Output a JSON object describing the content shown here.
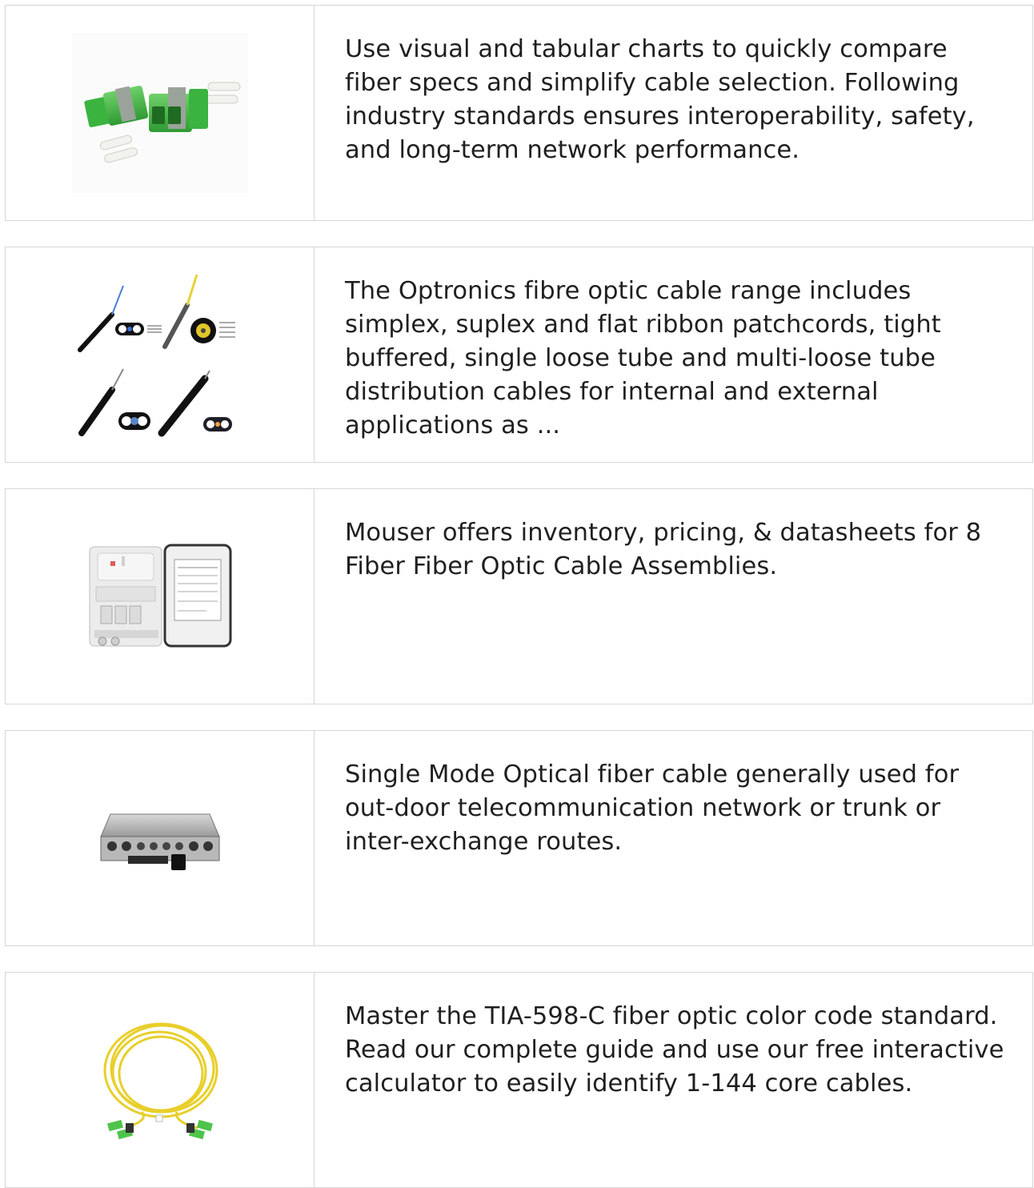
{
  "cards": [
    {
      "image": "green-lc-fiber-adapters-image",
      "text": "Use visual and tabular charts to quickly compare fiber specs and simplify cable selection. Following industry standards ensures interoperability, safety, and long-term network performance."
    },
    {
      "image": "fiber-optic-drop-cable-cross-sections-image",
      "text": "The Optronics fibre optic cable range includes simplex, suplex and flat ribbon patchcords, tight buffered, single loose tube and multi-loose tube distribution cables for internal and external applications as ..."
    },
    {
      "image": "fiber-distribution-box-image",
      "text": "Mouser offers inventory, pricing, & datasheets for 8 Fiber Fiber Optic Cable Assemblies."
    },
    {
      "image": "fiber-terminal-enclosure-image",
      "text": "Single Mode Optical fiber cable generally used for out-door telecommunication network or trunk or inter-exchange routes."
    },
    {
      "image": "yellow-fiber-patch-cord-image",
      "text": "Master the TIA-598-C fiber optic color code standard. Read our complete guide and use our free interactive calculator to easily identify 1-144 core cables."
    }
  ]
}
